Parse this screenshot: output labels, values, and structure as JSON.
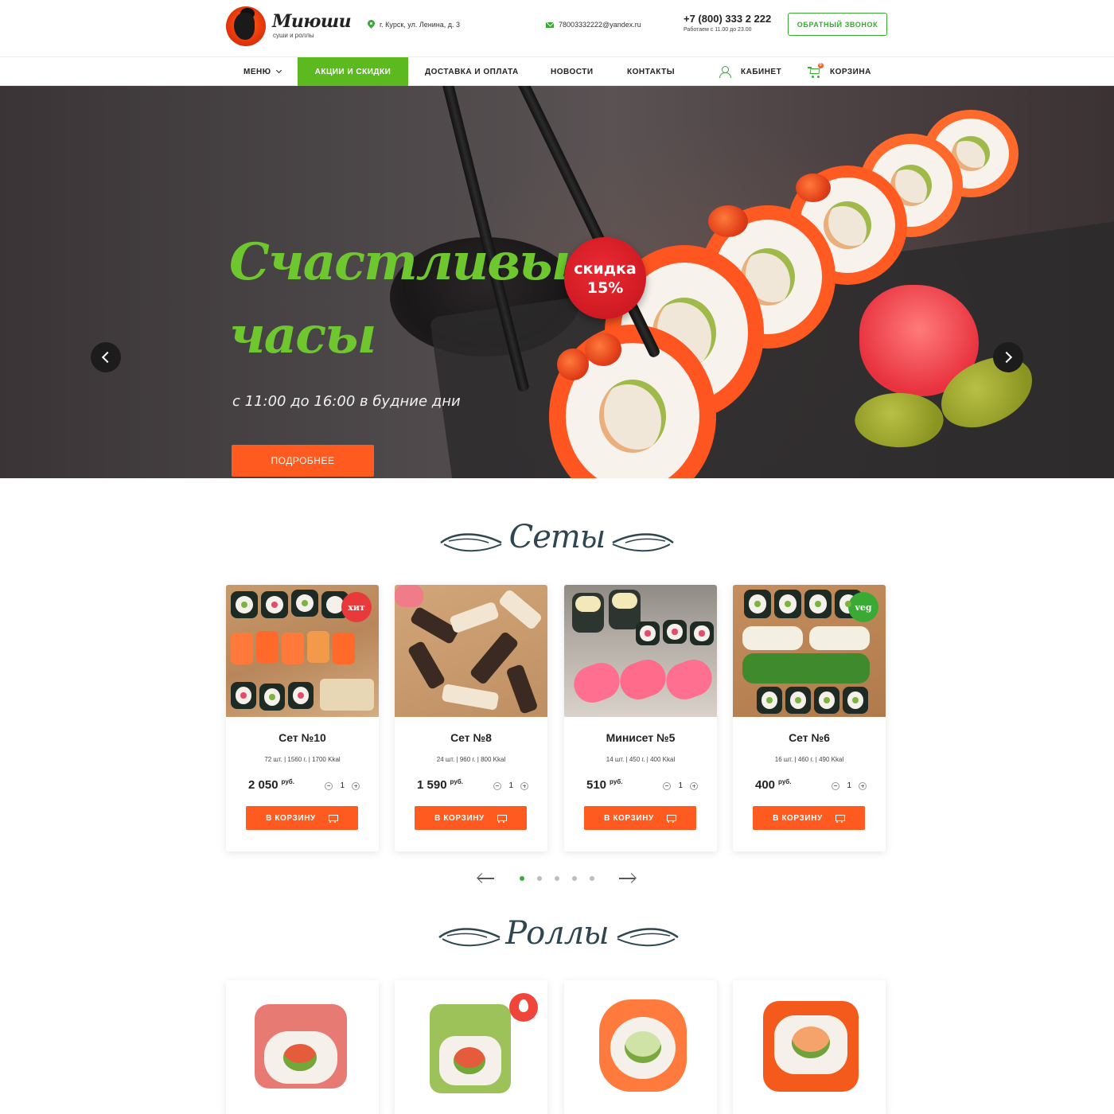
{
  "header": {
    "brand": "Миюши",
    "tagline": "суши и роллы",
    "address": "г. Курск, ул. Ленина, д. 3",
    "email": "78003332222@yandex.ru",
    "phone": "+7 (800) 333 2 222",
    "hours": "Работаем с 11.00 до 23.00",
    "callback": "ОБРАТНЫЙ ЗВОНОК"
  },
  "nav": {
    "menu": "МЕНЮ",
    "promo": "АКЦИИ И СКИДКИ",
    "delivery": "ДОСТАВКА И ОПЛАТА",
    "news": "НОВОСТИ",
    "contacts": "КОНТАКТЫ",
    "cabinet": "КАБИНЕТ",
    "cart": "КОРЗИНА",
    "cart_count": "0"
  },
  "hero": {
    "title_line1": "Счастливые",
    "title_line2": "часы",
    "subtitle": "с 11:00 до 16:00 в будние дни",
    "button": "ПОДРОБНЕЕ",
    "discount_line1": "скидка",
    "discount_line2": "15%",
    "active_slide": 3,
    "slide_count": 3
  },
  "sets": {
    "title": "Сеты",
    "currency": "руб.",
    "add_label": "В КОРЗИНУ",
    "items": [
      {
        "name": "Сет №10",
        "meta": "72 шт. | 1560 г. | 1700 Kkal",
        "price": "2 050",
        "qty": "1",
        "badge": "хит"
      },
      {
        "name": "Сет №8",
        "meta": "24 шт. | 960 г. | 800 Kkal",
        "price": "1 590",
        "qty": "1",
        "badge": ""
      },
      {
        "name": "Минисет №5",
        "meta": "14 шт. | 450 г. | 400 Kkal",
        "price": "510",
        "qty": "1",
        "badge": ""
      },
      {
        "name": "Сет №6",
        "meta": "16 шт. | 460 г. | 490 Kkal",
        "price": "400",
        "qty": "1",
        "badge": "veg"
      }
    ],
    "pager_pages": 5,
    "pager_active": 1
  },
  "rolls": {
    "title": "Роллы"
  },
  "colors": {
    "green": "#3aaa35",
    "nav_active": "#5cb91f",
    "orange": "#ff5a1f",
    "red_badge": "#e83a3a",
    "title_dark": "#2f4650"
  },
  "icons": [
    "map-pin-icon",
    "mail-icon",
    "chevron-down-icon",
    "user-icon",
    "cart-icon",
    "arrow-left-icon",
    "arrow-right-icon",
    "minus-icon",
    "plus-icon",
    "fire-icon"
  ]
}
